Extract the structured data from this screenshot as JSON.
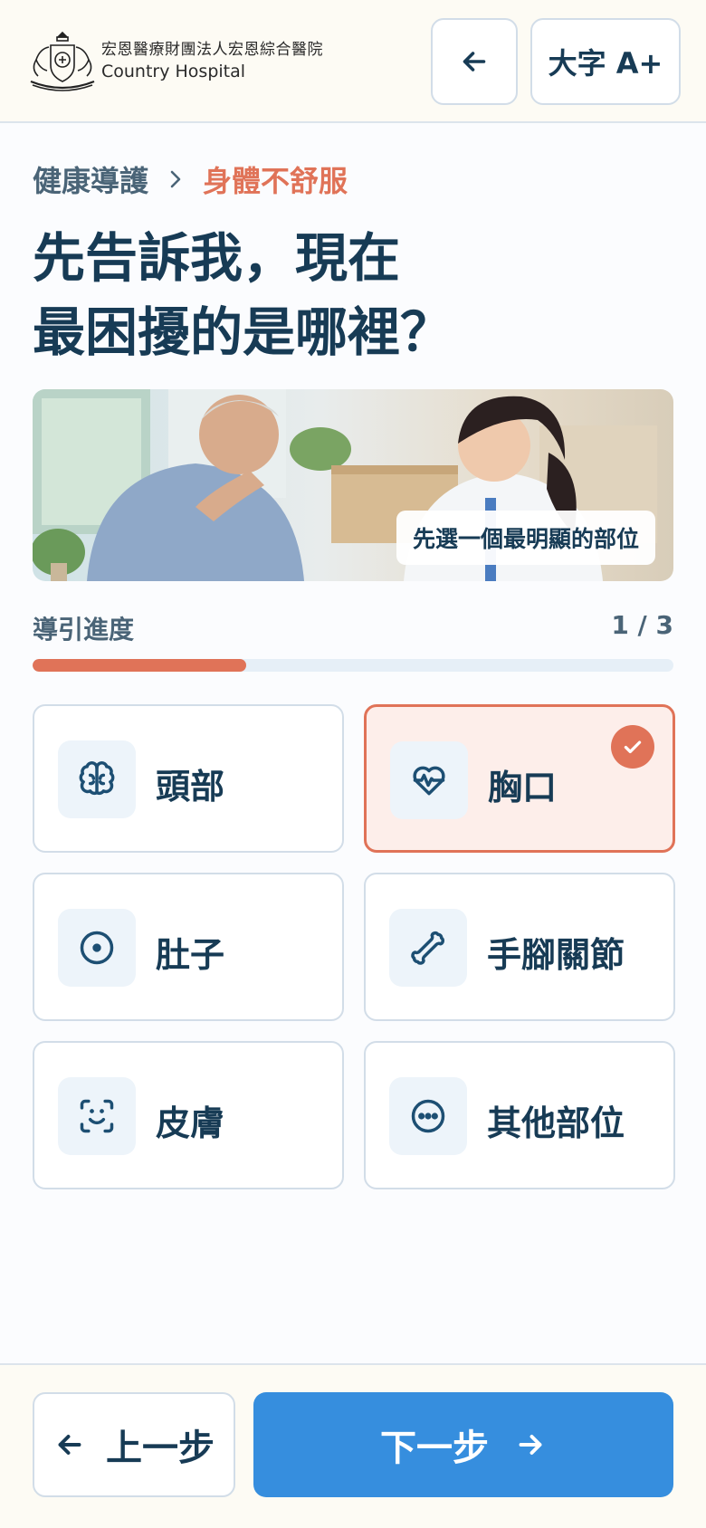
{
  "header": {
    "logo_icon": "hospital-crest-icon",
    "org_name_cn": "宏恩醫療財團法人宏恩綜合醫院",
    "org_name_en": "Country Hospital",
    "back_icon": "arrow-left-icon",
    "font_size_label": "大字 A+"
  },
  "breadcrumb": {
    "parent": "健康導護",
    "separator_icon": "chevron-right-icon",
    "current": "身體不舒服"
  },
  "title": {
    "line1": "先告訴我，現在",
    "line2": "最困擾的是哪裡？"
  },
  "hero": {
    "caption": "先選一個最明顯的部位"
  },
  "progress": {
    "label": "導引進度",
    "count": "1 / 3",
    "current_step": 1,
    "total_steps": 3
  },
  "options": [
    {
      "label": "頭部",
      "icon": "brain-icon",
      "selected": false
    },
    {
      "label": "胸口",
      "icon": "heart-pulse-icon",
      "selected": true
    },
    {
      "label": "肚子",
      "icon": "circle-dot-icon",
      "selected": false
    },
    {
      "label": "手腳關節",
      "icon": "bone-icon",
      "selected": false
    },
    {
      "label": "皮膚",
      "icon": "face-scan-icon",
      "selected": false
    },
    {
      "label": "其他部位",
      "icon": "ellipsis-circle-icon",
      "selected": false
    }
  ],
  "footer": {
    "prev_label": "上一步",
    "next_label": "下一步"
  },
  "colors": {
    "primary_text": "#173b55",
    "accent": "#e07358",
    "primary_button": "#368ede",
    "selected_bg": "#fdeeea"
  }
}
